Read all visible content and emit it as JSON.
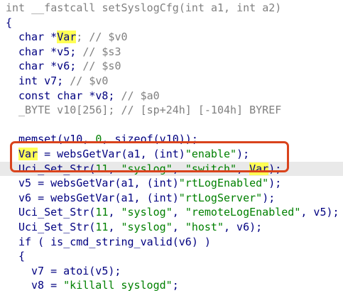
{
  "code": {
    "lines": [
      {
        "indent": 0,
        "state": "normal",
        "tokens": [
          {
            "t": "int __fastcall setSyslogCfg(int a1, int a2)",
            "c": "greyed"
          }
        ]
      },
      {
        "indent": 0,
        "state": "normal",
        "tokens": [
          {
            "t": "{",
            "c": ""
          }
        ]
      },
      {
        "indent": 2,
        "state": "normal",
        "tokens": [
          {
            "t": "char *",
            "c": ""
          },
          {
            "t": "Var",
            "c": "hl"
          },
          {
            "t": "; // $v0",
            "c": "cm"
          }
        ]
      },
      {
        "indent": 2,
        "state": "normal",
        "tokens": [
          {
            "t": "char *v5; ",
            "c": ""
          },
          {
            "t": "// $s3",
            "c": "cm"
          }
        ]
      },
      {
        "indent": 2,
        "state": "normal",
        "tokens": [
          {
            "t": "char *v6; ",
            "c": ""
          },
          {
            "t": "// $s0",
            "c": "cm"
          }
        ]
      },
      {
        "indent": 2,
        "state": "normal",
        "tokens": [
          {
            "t": "int v7; ",
            "c": ""
          },
          {
            "t": "// $v0",
            "c": "cm"
          }
        ]
      },
      {
        "indent": 2,
        "state": "normal",
        "tokens": [
          {
            "t": "const char *v8; ",
            "c": ""
          },
          {
            "t": "// $a0",
            "c": "cm"
          }
        ]
      },
      {
        "indent": 2,
        "state": "normal",
        "tokens": [
          {
            "t": "_BYTE v10[256]; // [sp+24h] [-104h] BYREF",
            "c": "greyed"
          }
        ]
      },
      {
        "indent": 0,
        "state": "normal",
        "tokens": []
      },
      {
        "indent": 2,
        "state": "normal",
        "tokens": [
          {
            "t": "memset(v10, ",
            "c": ""
          },
          {
            "t": "0",
            "c": "num"
          },
          {
            "t": ", sizeof(v10));",
            "c": ""
          }
        ]
      },
      {
        "indent": 2,
        "state": "normal",
        "tokens": [
          {
            "t": "Var",
            "c": "hl"
          },
          {
            "t": " = websGetVar(a1, (int)",
            "c": ""
          },
          {
            "t": "\"enable\"",
            "c": "str"
          },
          {
            "t": ");",
            "c": ""
          }
        ]
      },
      {
        "indent": 2,
        "state": "current",
        "tokens": [
          {
            "t": "Uci_Set_Str(",
            "c": ""
          },
          {
            "t": "11",
            "c": "num"
          },
          {
            "t": ", ",
            "c": ""
          },
          {
            "t": "\"syslog\"",
            "c": "str"
          },
          {
            "t": ", ",
            "c": ""
          },
          {
            "t": "\"switch\"",
            "c": "str"
          },
          {
            "t": ", ",
            "c": ""
          },
          {
            "t": "Var",
            "c": "hl"
          },
          {
            "t": ");",
            "c": ""
          }
        ]
      },
      {
        "indent": 2,
        "state": "normal",
        "tokens": [
          {
            "t": "v5 = websGetVar(a1, (int)",
            "c": ""
          },
          {
            "t": "\"rtLogEnabled\"",
            "c": "str"
          },
          {
            "t": ");",
            "c": ""
          }
        ]
      },
      {
        "indent": 2,
        "state": "normal",
        "tokens": [
          {
            "t": "v6 = websGetVar(a1, (int)",
            "c": ""
          },
          {
            "t": "\"rtLogServer\"",
            "c": "str"
          },
          {
            "t": ");",
            "c": ""
          }
        ]
      },
      {
        "indent": 2,
        "state": "normal",
        "tokens": [
          {
            "t": "Uci_Set_Str(",
            "c": ""
          },
          {
            "t": "11",
            "c": "num"
          },
          {
            "t": ", ",
            "c": ""
          },
          {
            "t": "\"syslog\"",
            "c": "str"
          },
          {
            "t": ", ",
            "c": ""
          },
          {
            "t": "\"remoteLogEnabled\"",
            "c": "str"
          },
          {
            "t": ", v5);",
            "c": ""
          }
        ]
      },
      {
        "indent": 2,
        "state": "normal",
        "tokens": [
          {
            "t": "Uci_Set_Str(",
            "c": ""
          },
          {
            "t": "11",
            "c": "num"
          },
          {
            "t": ", ",
            "c": ""
          },
          {
            "t": "\"syslog\"",
            "c": "str"
          },
          {
            "t": ", ",
            "c": ""
          },
          {
            "t": "\"host\"",
            "c": "str"
          },
          {
            "t": ", v6);",
            "c": ""
          }
        ]
      },
      {
        "indent": 2,
        "state": "normal",
        "tokens": [
          {
            "t": "if ( is_cmd_string_valid(v6) )",
            "c": ""
          }
        ]
      },
      {
        "indent": 2,
        "state": "normal",
        "tokens": [
          {
            "t": "{",
            "c": ""
          }
        ]
      },
      {
        "indent": 4,
        "state": "normal",
        "tokens": [
          {
            "t": "v7 = atoi(v5);",
            "c": ""
          }
        ]
      },
      {
        "indent": 4,
        "state": "normal",
        "tokens": [
          {
            "t": "v8 = ",
            "c": ""
          },
          {
            "t": "\"killall syslogd\"",
            "c": "str"
          },
          {
            "t": ";",
            "c": ""
          }
        ]
      }
    ]
  },
  "colors": {
    "code_text": "#000080",
    "comment": "#808080",
    "string": "#008000",
    "highlight": "#ffff55",
    "current_line": "#e9e9e9",
    "annotation_box": "#d9431c"
  }
}
